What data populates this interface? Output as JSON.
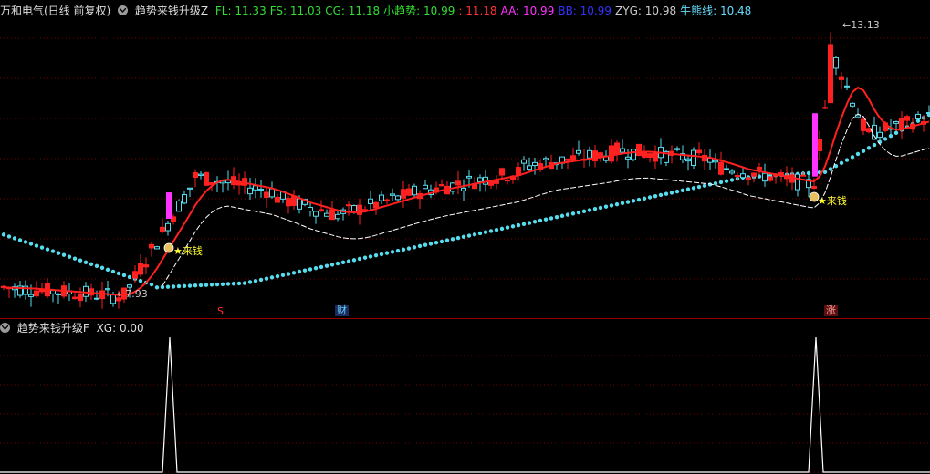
{
  "main_header": {
    "stock": "万和电气(日线 前复权)",
    "indicator": "趋势来钱升级Z",
    "values": [
      {
        "label": "FL: 11.33",
        "color": "#33dd33"
      },
      {
        "label": "FS: 11.03",
        "color": "#33dd33"
      },
      {
        "label": "CG: 11.18",
        "color": "#33dd33"
      },
      {
        "label": "小趋势: 10.99",
        "color": "#33dd33"
      },
      {
        "label": ": 11.18",
        "color": "#ff3333"
      },
      {
        "label": "AA: 10.99",
        "color": "#ff33ff"
      },
      {
        "label": "BB: 10.99",
        "color": "#3333ff"
      },
      {
        "label": "ZYG: 10.98",
        "color": "#cccccc"
      },
      {
        "label": "牛熊线: 10.48",
        "color": "#66ddff"
      }
    ]
  },
  "sub_header": {
    "indicator": "趋势来钱升级F",
    "value": "XG: 0.00"
  },
  "annotations": {
    "high": "13.13",
    "low": "7.93",
    "signal_1": "来钱",
    "signal_2": "来钱",
    "signal_icon": "money-bag-icon"
  },
  "event_markers": [
    {
      "text": "S",
      "color": "#ff3333"
    },
    {
      "text": "财",
      "color": "#66ccff"
    },
    {
      "text": "涨",
      "color": "#ff6666"
    }
  ],
  "colors": {
    "up": "#ff2020",
    "down": "#55ddee",
    "ma": "#ff2020",
    "dots": "#55ddee",
    "signal_bar": "#ff33ff",
    "grid": "#7a0000"
  },
  "chart_data": {
    "type": "candlestick",
    "price_range": [
      7.7,
      13.4
    ],
    "xg_range": [
      0,
      1
    ],
    "xg_signals": [
      1,
      1
    ],
    "high": 13.13,
    "low": 7.93
  }
}
